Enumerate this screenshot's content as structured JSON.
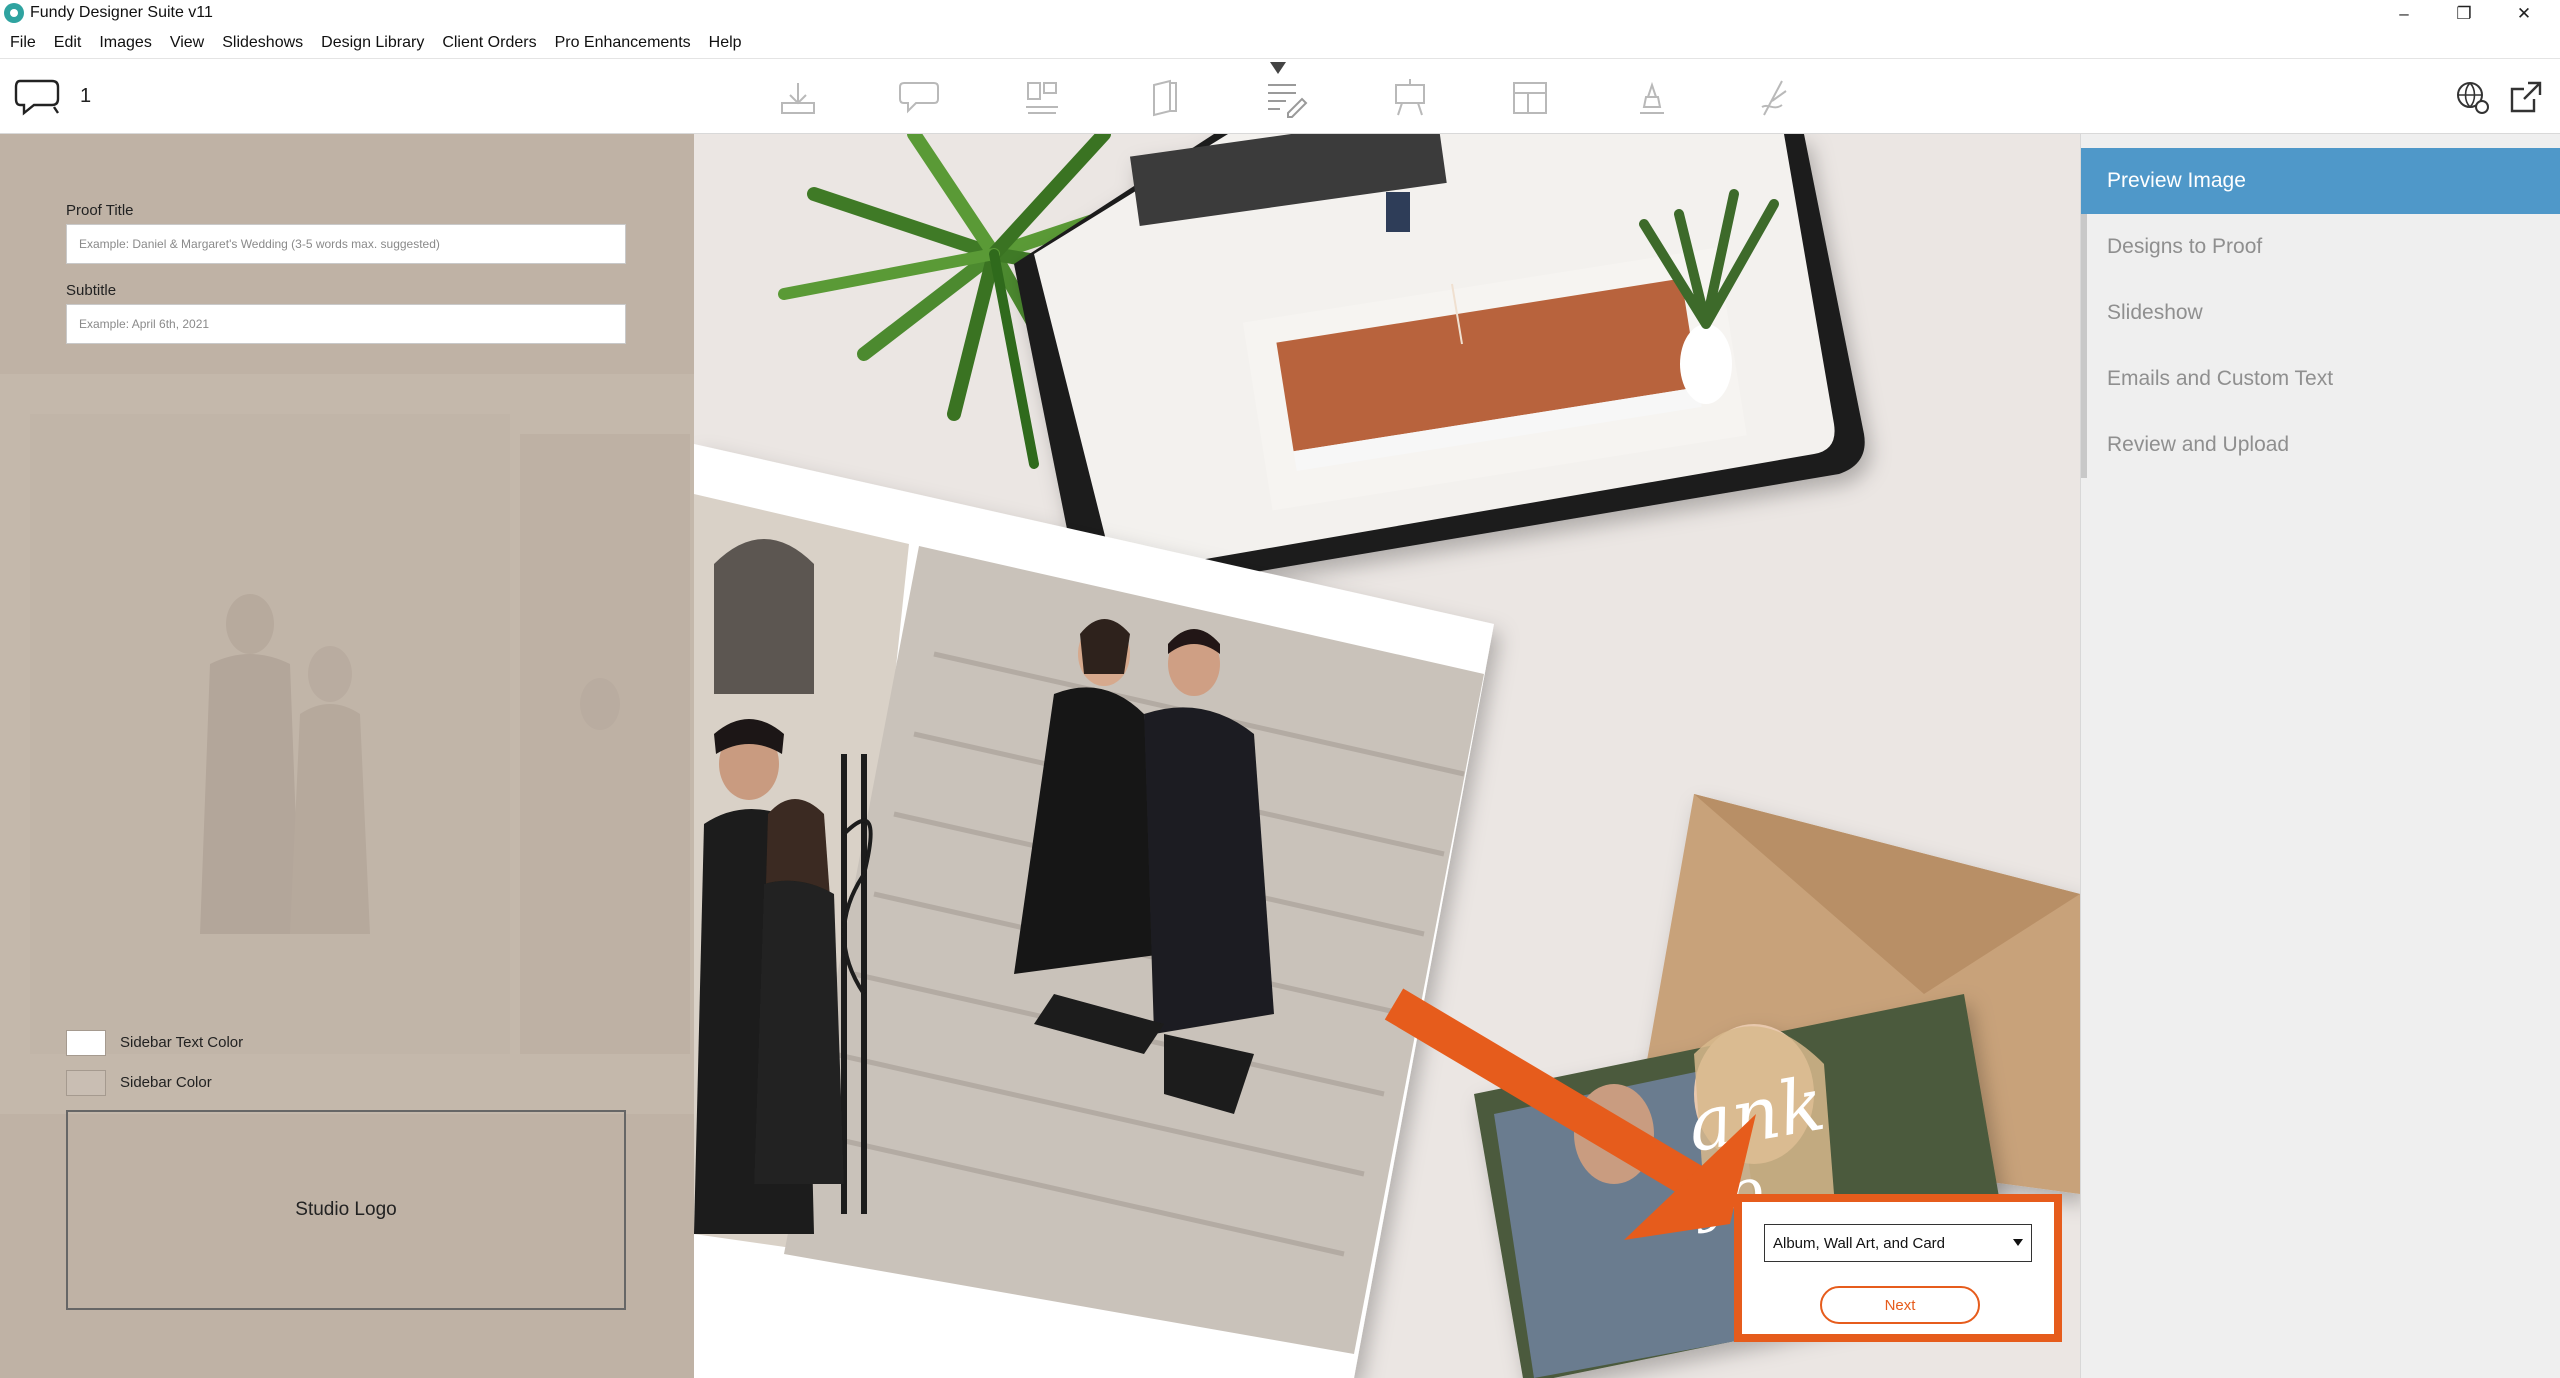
{
  "window": {
    "title": "Fundy Designer Suite v11",
    "controls": {
      "minimize": "–",
      "maximize": "❐",
      "close": "✕"
    }
  },
  "menu": [
    "File",
    "Edit",
    "Images",
    "View",
    "Slideshows",
    "Design Library",
    "Client Orders",
    "Pro Enhancements",
    "Help"
  ],
  "toolbar": {
    "proof_count": "1",
    "tools": [
      "import-icon",
      "proofing-icon",
      "album-icon",
      "card-icon",
      "text-edit-icon",
      "wall-art-icon",
      "layout-icon",
      "enhance-icon",
      "sign-icon"
    ],
    "right_tools": [
      "settings-globe-icon",
      "external-link-icon"
    ]
  },
  "left_panel": {
    "proof_title_label": "Proof Title",
    "proof_title_placeholder": "Example: Daniel & Margaret's Wedding (3-5 words max. suggested)",
    "subtitle_label": "Subtitle",
    "subtitle_placeholder": "Example: April 6th, 2021",
    "sidebar_text_color_label": "Sidebar Text Color",
    "sidebar_color_label": "Sidebar Color",
    "studio_logo_label": "Studio Logo",
    "colors": {
      "background": "#bfb2a5",
      "sidebar_text_color": "#ffffff",
      "sidebar_color": "#c9beb3"
    }
  },
  "preview": {
    "card_text": "ank",
    "card_text_2": "yo",
    "design_type": "Album, Wall Art, and Card",
    "next_label": "Next",
    "accent_color": "#e65c1c"
  },
  "steps": [
    {
      "label": "Preview Image",
      "active": true
    },
    {
      "label": "Designs to Proof",
      "active": false
    },
    {
      "label": "Slideshow",
      "active": false
    },
    {
      "label": "Emails and Custom Text",
      "active": false
    },
    {
      "label": "Review and Upload",
      "active": false
    }
  ]
}
